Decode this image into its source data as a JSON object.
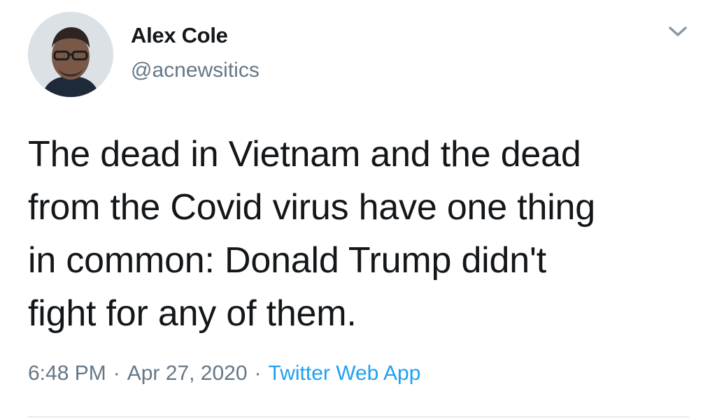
{
  "tweet": {
    "author": {
      "display_name": "Alex Cole",
      "handle": "@acnewsitics",
      "avatar_icon": "profile-photo"
    },
    "text_lines": [
      "The dead in Vietnam and the dead",
      "from the Covid virus have one thing",
      "in common:  Donald Trump didn't",
      "fight for any of them."
    ],
    "meta": {
      "time": "6:48 PM",
      "separator": "·",
      "date": "Apr 27, 2020",
      "source": "Twitter Web App"
    },
    "menu_icon": "chevron-down-icon"
  },
  "colors": {
    "text": "#14171a",
    "secondary": "#657786",
    "link": "#1da1f2",
    "divider": "#e6ecf0"
  }
}
